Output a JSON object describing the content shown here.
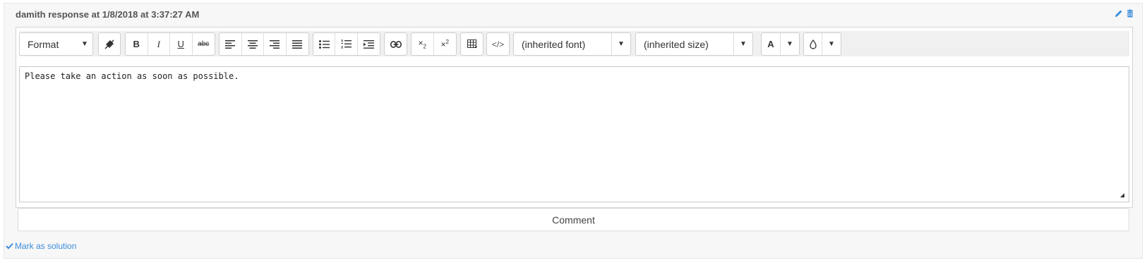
{
  "header": {
    "title": "damith response at 1/8/2018 at 3:37:27 AM",
    "accent": "#3c8dd8"
  },
  "toolbar": {
    "format_label": "Format",
    "bold_label": "B",
    "italic_label": "I",
    "underline_label": "U",
    "strike_label": "abc",
    "font_label": "(inherited font)",
    "size_label": "(inherited size)",
    "font_color_label": "A"
  },
  "editor": {
    "content": "Please take an action as soon as possible."
  },
  "comment_button": {
    "label": "Comment"
  },
  "mark_solution": {
    "label": "Mark as solution"
  }
}
